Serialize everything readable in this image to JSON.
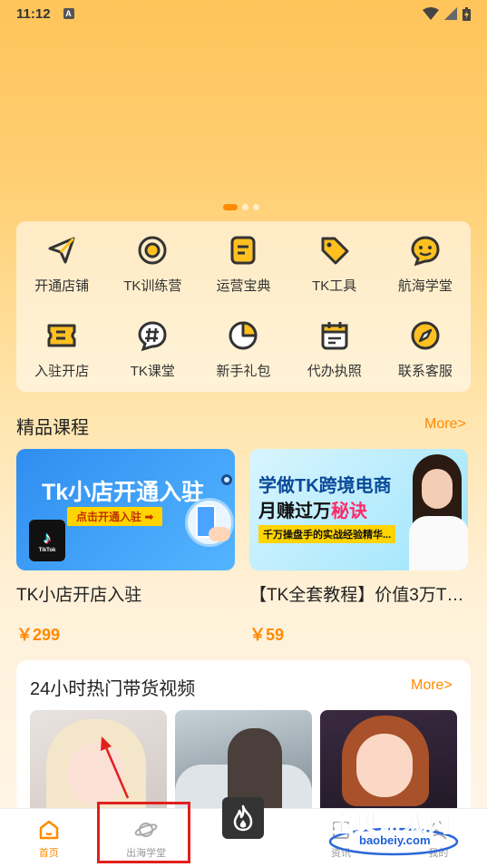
{
  "status_bar": {
    "time": "11:12",
    "badge": "A"
  },
  "banner": {
    "dots": 3,
    "active_dot": 0
  },
  "grid": [
    {
      "label": "开通店铺",
      "icon": "paper-plane-icon"
    },
    {
      "label": "TK训练营",
      "icon": "target-icon"
    },
    {
      "label": "运营宝典",
      "icon": "book-icon"
    },
    {
      "label": "TK工具",
      "icon": "tag-icon"
    },
    {
      "label": "航海学堂",
      "icon": "chat-smile-icon"
    },
    {
      "label": "入驻开店",
      "icon": "ticket-icon"
    },
    {
      "label": "TK课堂",
      "icon": "hashtag-icon"
    },
    {
      "label": "新手礼包",
      "icon": "pie-chart-icon"
    },
    {
      "label": "代办执照",
      "icon": "calendar-icon"
    },
    {
      "label": "联系客服",
      "icon": "compass-icon"
    }
  ],
  "courses": {
    "title": "精品课程",
    "more": "More>",
    "items": [
      {
        "title": "TK小店开店入驻",
        "price": "￥299",
        "banner_title": "Tk小店开通入驻",
        "banner_sub": "点击开通入驻 ➡",
        "logo": "TikTok"
      },
      {
        "title": "【TK全套教程】价值3万TK…",
        "price": "￥59",
        "banner_title1": "学做TK跨境电商",
        "banner_title2_a": "月赚过万",
        "banner_title2_b": "秘诀",
        "banner_sub": "千万操盘手的实战经验精华..."
      }
    ]
  },
  "hot": {
    "title": "24小时热门带货视频",
    "more": "More>"
  },
  "tabbar": [
    {
      "label": "首页",
      "icon": "home-icon",
      "active": true
    },
    {
      "label": "出海学堂",
      "icon": "planet-icon",
      "active": false
    },
    {
      "label": "",
      "icon": "flame-icon",
      "active": false
    },
    {
      "label": "资讯",
      "icon": "news-icon",
      "active": false
    },
    {
      "label": "我的",
      "icon": "user-icon",
      "active": false
    }
  ],
  "watermark": {
    "line1": "宝贝游戏网",
    "line2": "baobeiy.com"
  },
  "colors": {
    "accent": "#ff8a00",
    "annotation": "#e0201c"
  }
}
